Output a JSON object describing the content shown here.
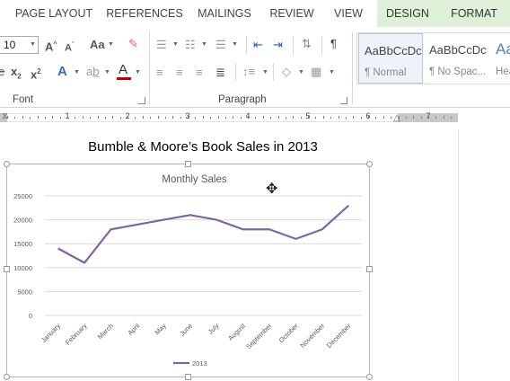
{
  "ribbon_tabs": [
    {
      "label": "PAGE LAYOUT",
      "contextual": false
    },
    {
      "label": "REFERENCES",
      "contextual": false
    },
    {
      "label": "MAILINGS",
      "contextual": false
    },
    {
      "label": "REVIEW",
      "contextual": false
    },
    {
      "label": "VIEW",
      "contextual": false
    },
    {
      "label": "DESIGN",
      "contextual": true
    },
    {
      "label": "FORMAT",
      "contextual": true
    }
  ],
  "font_group": {
    "label": "Font",
    "font_size": "10",
    "icons": [
      "grow-font-icon",
      "shrink-font-icon",
      "change-case-icon",
      "clear-formatting-icon",
      "strikethrough-icon",
      "subscript-icon",
      "superscript-icon",
      "text-effects-icon",
      "highlight-icon",
      "font-color-icon"
    ],
    "font_color": "#c00000"
  },
  "paragraph_group": {
    "label": "Paragraph",
    "icons": [
      "bullets-icon",
      "numbering-icon",
      "multilevel-list-icon",
      "decrease-indent-icon",
      "increase-indent-icon",
      "sort-icon",
      "show-marks-icon",
      "align-left-icon",
      "center-icon",
      "align-right-icon",
      "justify-icon",
      "line-spacing-icon",
      "shading-icon",
      "borders-icon"
    ]
  },
  "styles": [
    {
      "sample": "AaBbCcDc",
      "name": "¶ Normal",
      "selected": true
    },
    {
      "sample": "AaBbCcDc",
      "name": "¶ No Spac...",
      "selected": false
    },
    {
      "sample": "Aa",
      "name": "Hea",
      "selected": false
    }
  ],
  "ruler": {
    "numbers": [
      "1",
      "2",
      "3",
      "4",
      "5",
      "6",
      "7"
    ]
  },
  "document": {
    "title": "Bumble & Moore’s Book Sales in 2013"
  },
  "chart_data": {
    "type": "line",
    "title": "Monthly Sales",
    "categories": [
      "January",
      "February",
      "March",
      "April",
      "May",
      "June",
      "July",
      "August",
      "September",
      "October",
      "November",
      "December"
    ],
    "series": [
      {
        "name": "2013",
        "values": [
          14000,
          11000,
          18000,
          19000,
          20000,
          21000,
          20000,
          18000,
          18000,
          16000,
          18000,
          23000
        ],
        "color": "#8064a2"
      }
    ],
    "ylim": [
      0,
      25000
    ],
    "yticks": [
      "0",
      "5000",
      "10000",
      "15000",
      "20000",
      "25000"
    ],
    "grid": true,
    "legend_position": "bottom"
  }
}
